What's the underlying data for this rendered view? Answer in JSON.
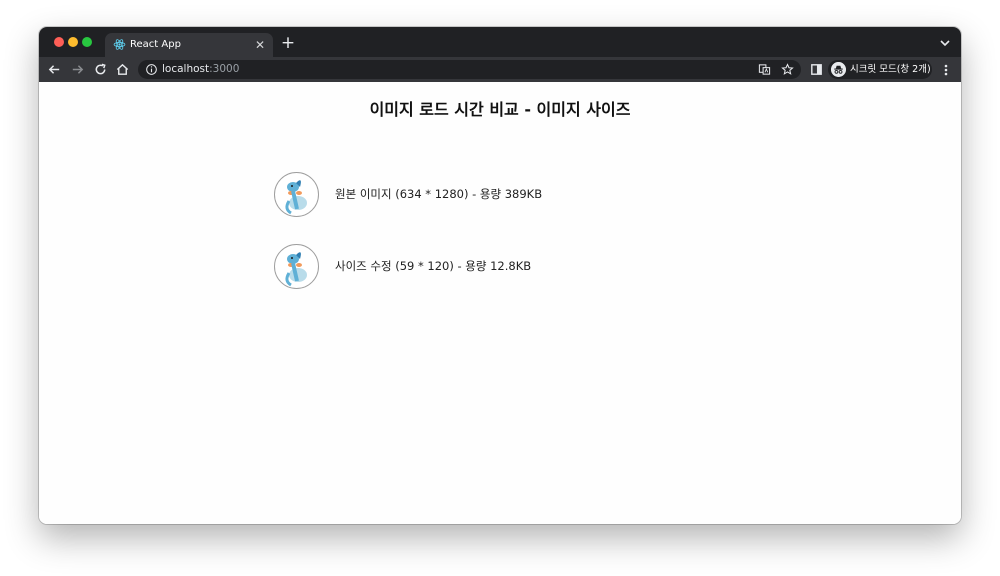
{
  "browser": {
    "tab": {
      "title": "React App",
      "icon": "react-logo-icon"
    },
    "address": {
      "host": "localhost",
      "port": ":3000"
    },
    "profile": {
      "label": "시크릿 모드(창 2개)"
    },
    "colors": {
      "titlebar": "#202124",
      "toolbar": "#35363a",
      "accent": "#61dafb"
    }
  },
  "page": {
    "heading": "이미지 로드 시간 비교 - 이미지 사이즈",
    "items": [
      {
        "caption": "원본 이미지 (634 * 1280) - 용량 389KB",
        "image": "mudkip-thumbnail"
      },
      {
        "caption": "사이즈 수정 (59 * 120) - 용량 12.8KB",
        "image": "mudkip-thumbnail"
      }
    ]
  }
}
